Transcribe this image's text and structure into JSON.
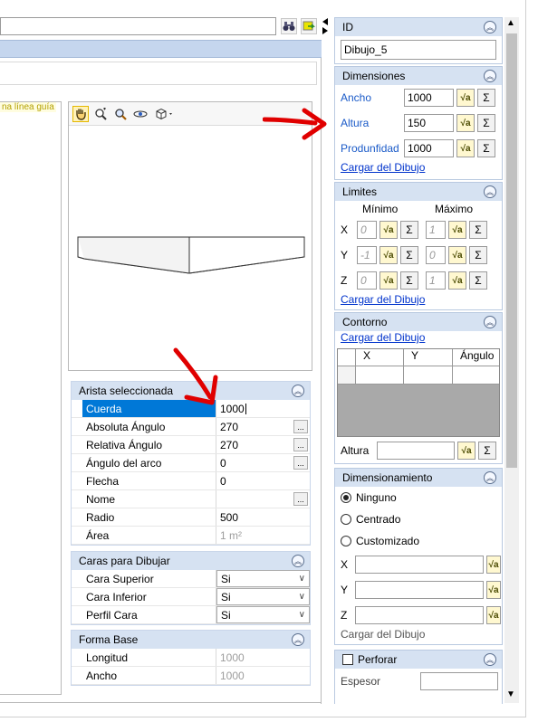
{
  "top": {
    "binoculars_icon": "binoculars-icon",
    "sync_icon": "sync-icon"
  },
  "left": {
    "guide_text": "na línea guía"
  },
  "arista": {
    "title": "Arista seleccionada",
    "rows": [
      {
        "name": "Cuerda",
        "value": "1000"
      },
      {
        "name": "Absoluta Ángulo",
        "value": "270"
      },
      {
        "name": "Relativa Ángulo",
        "value": "270"
      },
      {
        "name": "Ángulo del arco",
        "value": "0"
      },
      {
        "name": "Flecha",
        "value": "0"
      },
      {
        "name": "Nome",
        "value": ""
      },
      {
        "name": "Radio",
        "value": "500"
      },
      {
        "name": "Área",
        "value": "1 m²"
      }
    ]
  },
  "caras": {
    "title": "Caras para Dibujar",
    "rows": [
      {
        "name": "Cara Superior",
        "value": "Si"
      },
      {
        "name": "Cara Inferior",
        "value": "Si"
      },
      {
        "name": "Perfil Cara",
        "value": "Si"
      }
    ]
  },
  "forma": {
    "title": "Forma Base",
    "rows": [
      {
        "name": "Longitud",
        "value": "1000"
      },
      {
        "name": "Ancho",
        "value": "1000"
      }
    ]
  },
  "id_panel": {
    "title": "ID",
    "value": "Dibujo_5"
  },
  "dimensiones": {
    "title": "Dimensiones",
    "ancho_label": "Ancho",
    "ancho_value": "1000",
    "altura_label": "Altura",
    "altura_value": "150",
    "profundidad_label": "Produnfidad",
    "profundidad_value": "1000",
    "link": "Cargar del Dibujo"
  },
  "limites": {
    "title": "Limites",
    "min_label": "Mínimo",
    "max_label": "Máximo",
    "rows": [
      {
        "axis": "X",
        "min": "0",
        "max": "1"
      },
      {
        "axis": "Y",
        "min": "-1",
        "max": "0"
      },
      {
        "axis": "Z",
        "min": "0",
        "max": "1"
      }
    ],
    "link": "Cargar del Dibujo"
  },
  "contorno": {
    "title": "Contorno",
    "link": "Cargar del Dibujo",
    "headers": [
      "X",
      "Y",
      "Ángulo"
    ],
    "altura_label": "Altura",
    "altura_value": ""
  },
  "dimensionamiento": {
    "title": "Dimensionamiento",
    "options": [
      "Ninguno",
      "Centrado",
      "Customizado"
    ],
    "selected": "Ninguno",
    "x_label": "X",
    "y_label": "Y",
    "z_label": "Z",
    "link": "Cargar del Dibujo"
  },
  "perforar": {
    "title": "Perforar",
    "espesor_label": "Espesor",
    "espesor_value": ""
  },
  "symbols": {
    "sqrt": "√a",
    "sigma": "Σ",
    "dots": "...",
    "chev_up": "︽",
    "dropdown": "∨"
  }
}
